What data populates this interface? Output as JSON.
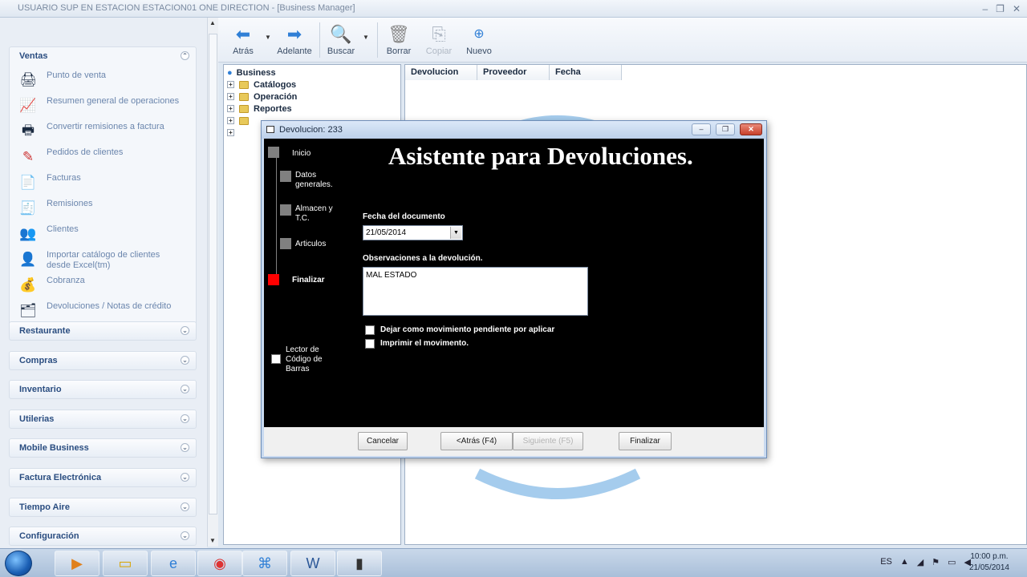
{
  "window": {
    "title": "USUARIO SUP EN ESTACION ESTACION01   ONE DIRECTION - [Business Manager]",
    "controls": [
      "‒",
      "❐",
      "✕"
    ]
  },
  "sidebar": {
    "ventas": {
      "header": "Ventas",
      "items": [
        {
          "label": "Punto de venta",
          "icon": "cash-register-icon"
        },
        {
          "label": "Resumen general de operaciones",
          "icon": "monitor-chart-icon"
        },
        {
          "label": "Convertir remisiones a factura",
          "icon": "printer-icon"
        },
        {
          "label": "Pedidos de clientes",
          "icon": "pencil-icon"
        },
        {
          "label": "Facturas",
          "icon": "document-icon"
        },
        {
          "label": "Remisiones",
          "icon": "receipt-icon"
        },
        {
          "label": "Clientes",
          "icon": "customers-icon"
        },
        {
          "label": "Importar catálogo de clientes desde Excel(tm)",
          "icon": "import-user-icon"
        },
        {
          "label": "Cobranza",
          "icon": "coins-icon"
        },
        {
          "label": "Devoluciones / Notas de crédito",
          "icon": "returns-icon"
        }
      ]
    },
    "sections": [
      "Restaurante",
      "Compras",
      "Inventario",
      "Utilerias",
      "Mobile Business",
      "Factura Electrónica",
      "Tiempo Aire",
      "Configuración"
    ]
  },
  "toolbar": {
    "back": "Atrás",
    "forward": "Adelante",
    "search": "Buscar",
    "delete": "Borrar",
    "copy": "Copiar",
    "new": "Nuevo"
  },
  "tree": {
    "root": "Business",
    "children": [
      "Catálogos",
      "Operación",
      "Reportes"
    ]
  },
  "list": {
    "columns": [
      "Devolucion",
      "Proveedor",
      "Fecha"
    ]
  },
  "dialog": {
    "title": "Devolucion: 233",
    "heading": "Asistente para Devoluciones.",
    "steps": [
      {
        "label": "Inicio"
      },
      {
        "label": "Datos generales."
      },
      {
        "label": "Almacen y T.C."
      },
      {
        "label": "Articulos"
      },
      {
        "label": "Finalizar"
      }
    ],
    "date_label": "Fecha del documento",
    "date_value": "21/05/2014",
    "obs_label": "Observaciones a la devolución.",
    "obs_value": "MAL ESTADO",
    "check_pending": "Dejar como movimiento pendiente por aplicar",
    "check_print": "Imprimir el movimento.",
    "barcode_label": "Lector de Código de Barras",
    "buttons": {
      "cancel": "Cancelar",
      "back": "<Atrás (F4)",
      "next": "Siguiente (F5)",
      "finish": "Finalizar"
    }
  },
  "taskbar": {
    "time": "10:00 p.m.",
    "date": "21/05/2014",
    "tray_es": "ES"
  },
  "colors": {
    "active_step": "#ff0000",
    "inactive_step": "#808080",
    "dialog_body": "#000000",
    "accent": "#2a4d80"
  }
}
